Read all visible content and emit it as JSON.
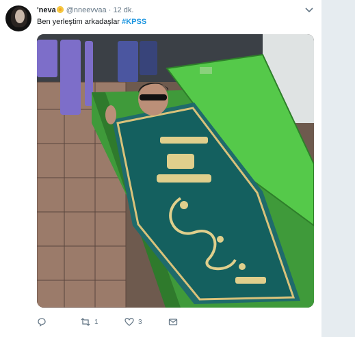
{
  "tweet": {
    "display_name": "'neva",
    "handle": "@nneevvaa",
    "separator": "·",
    "time": "12 dk.",
    "text": "Ben yerleştim arkadaşlar",
    "hashtag": "#KPSS",
    "replies": "",
    "retweets": "1",
    "likes": "3"
  },
  "icons": {
    "avatar": "avatar",
    "emoji": "sunflower-emoji",
    "menu": "chevron-down-icon",
    "reply": "reply-icon",
    "retweet": "retweet-icon",
    "like": "heart-icon",
    "dm": "envelope-icon"
  },
  "colors": {
    "link": "#1b95e0",
    "text": "#14171a",
    "muted": "#657786",
    "rail": "#e6ecf0"
  }
}
